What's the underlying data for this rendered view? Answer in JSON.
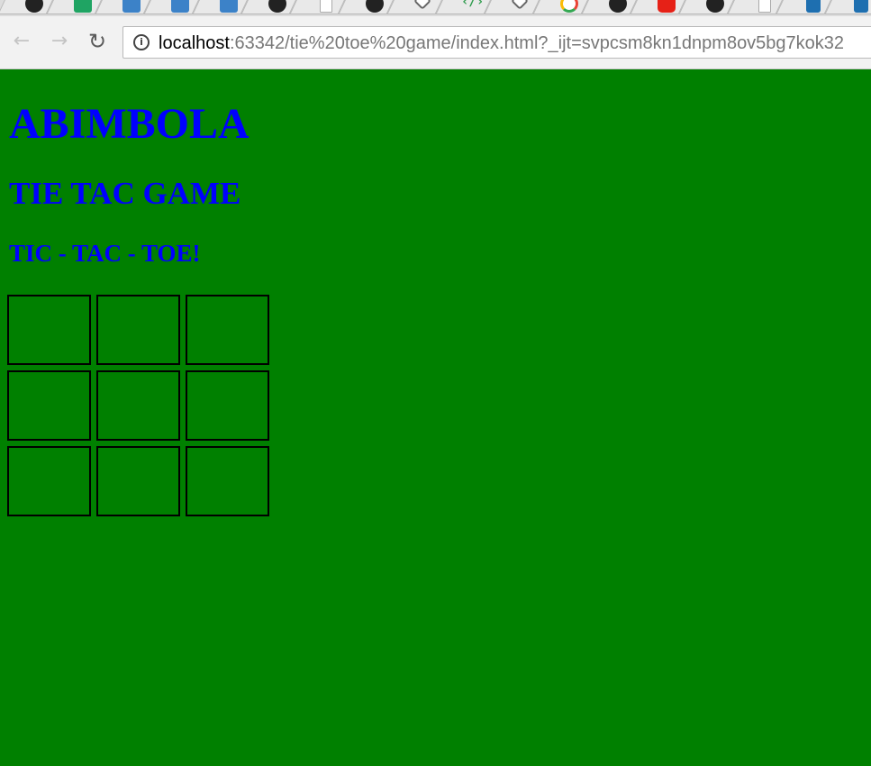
{
  "browser": {
    "tabs": [
      {
        "icon": "github-icon"
      },
      {
        "icon": "sheets-icon"
      },
      {
        "icon": "codex-icon"
      },
      {
        "icon": "codex-icon"
      },
      {
        "icon": "codex-icon"
      },
      {
        "icon": "github-icon"
      },
      {
        "icon": "document-icon"
      },
      {
        "icon": "github-icon"
      },
      {
        "icon": "layers-icon"
      },
      {
        "icon": "code-icon"
      },
      {
        "icon": "layers-icon"
      },
      {
        "icon": "google-icon"
      },
      {
        "icon": "github-icon"
      },
      {
        "icon": "youtube-icon"
      },
      {
        "icon": "github-icon"
      },
      {
        "icon": "document-icon"
      },
      {
        "icon": "ide-icon"
      },
      {
        "icon": "ide-icon"
      }
    ],
    "nav": {
      "back_glyph": "←",
      "forward_glyph": "→",
      "reload_glyph": "↻",
      "info_glyph": "i"
    },
    "url_host": "localhost",
    "url_rest": ":63342/tie%20toe%20game/index.html?_ijt=svpcsm8kn1dnpm8ov5bg7kok32"
  },
  "page": {
    "heading1": "ABIMBOLA",
    "heading2": "TIE TAC GAME",
    "heading3": "TIC - TAC - TOE!",
    "board": {
      "cells": [
        "",
        "",
        "",
        "",
        "",
        "",
        "",
        "",
        ""
      ]
    }
  },
  "colors": {
    "page_background": "#008000",
    "heading_text": "#0000ff",
    "cell_border": "#000000"
  }
}
